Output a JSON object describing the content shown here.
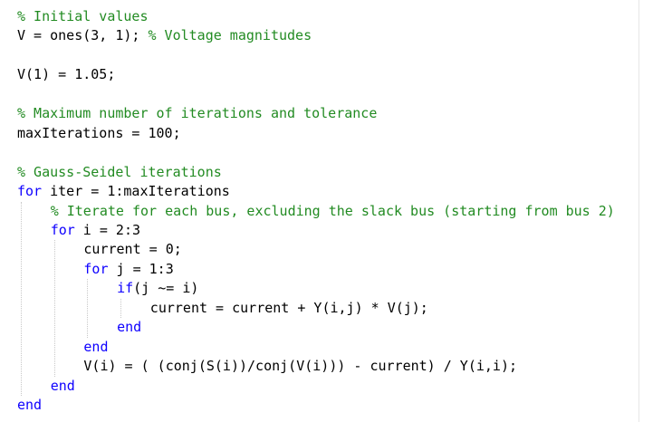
{
  "editor": {
    "lines": [
      {
        "id": "l1",
        "indent": 0,
        "tokens": [
          {
            "t": "comment",
            "v": "% Initial values"
          }
        ]
      },
      {
        "id": "l2",
        "indent": 0,
        "tokens": [
          {
            "t": "plain",
            "v": "V = ones(3, 1); "
          },
          {
            "t": "comment",
            "v": "% Voltage magnitudes"
          }
        ]
      },
      {
        "id": "l3",
        "indent": 0,
        "tokens": []
      },
      {
        "id": "l4",
        "indent": 0,
        "tokens": [
          {
            "t": "plain",
            "v": "V(1) = 1.05;"
          }
        ]
      },
      {
        "id": "l5",
        "indent": 0,
        "tokens": []
      },
      {
        "id": "l6",
        "indent": 0,
        "tokens": [
          {
            "t": "comment",
            "v": "% Maximum number of iterations and tolerance"
          }
        ]
      },
      {
        "id": "l7",
        "indent": 0,
        "tokens": [
          {
            "t": "plain",
            "v": "maxIterations = 100;"
          }
        ]
      },
      {
        "id": "l8",
        "indent": 0,
        "tokens": []
      },
      {
        "id": "l9",
        "indent": 0,
        "tokens": [
          {
            "t": "comment",
            "v": "% Gauss-Seidel iterations"
          }
        ]
      },
      {
        "id": "l10",
        "indent": 0,
        "tokens": [
          {
            "t": "keyword",
            "v": "for"
          },
          {
            "t": "plain",
            "v": " iter = 1:maxIterations"
          }
        ]
      },
      {
        "id": "l11",
        "indent": 1,
        "tokens": [
          {
            "t": "comment",
            "v": "% Iterate for each bus, excluding the slack bus (starting from bus 2)"
          }
        ]
      },
      {
        "id": "l12",
        "indent": 1,
        "tokens": [
          {
            "t": "keyword",
            "v": "for"
          },
          {
            "t": "plain",
            "v": " i = 2:3"
          }
        ]
      },
      {
        "id": "l13",
        "indent": 2,
        "tokens": [
          {
            "t": "plain",
            "v": "current = 0;"
          }
        ]
      },
      {
        "id": "l14",
        "indent": 2,
        "tokens": [
          {
            "t": "keyword",
            "v": "for"
          },
          {
            "t": "plain",
            "v": " j = 1:3"
          }
        ]
      },
      {
        "id": "l15",
        "indent": 3,
        "tokens": [
          {
            "t": "keyword",
            "v": "if"
          },
          {
            "t": "plain",
            "v": "(j ~= i)"
          }
        ]
      },
      {
        "id": "l16",
        "indent": 4,
        "tokens": [
          {
            "t": "plain",
            "v": "current = current + Y(i,j) * V(j);"
          }
        ]
      },
      {
        "id": "l17",
        "indent": 3,
        "tokens": [
          {
            "t": "keyword",
            "v": "end"
          }
        ]
      },
      {
        "id": "l18",
        "indent": 2,
        "tokens": [
          {
            "t": "keyword",
            "v": "end"
          }
        ]
      },
      {
        "id": "l19",
        "indent": 2,
        "tokens": [
          {
            "t": "plain",
            "v": "V(i) = ( (conj(S(i))/conj(V(i))) - current) / Y(i,i);"
          }
        ]
      },
      {
        "id": "l20",
        "indent": 1,
        "tokens": [
          {
            "t": "keyword",
            "v": "end"
          }
        ]
      },
      {
        "id": "l21",
        "indent": 0,
        "tokens": [
          {
            "t": "keyword",
            "v": "end"
          }
        ]
      }
    ]
  },
  "colors": {
    "comment": "#228B22",
    "keyword": "#0E00FF",
    "plain": "#000000",
    "background": "#FFFFFF"
  }
}
